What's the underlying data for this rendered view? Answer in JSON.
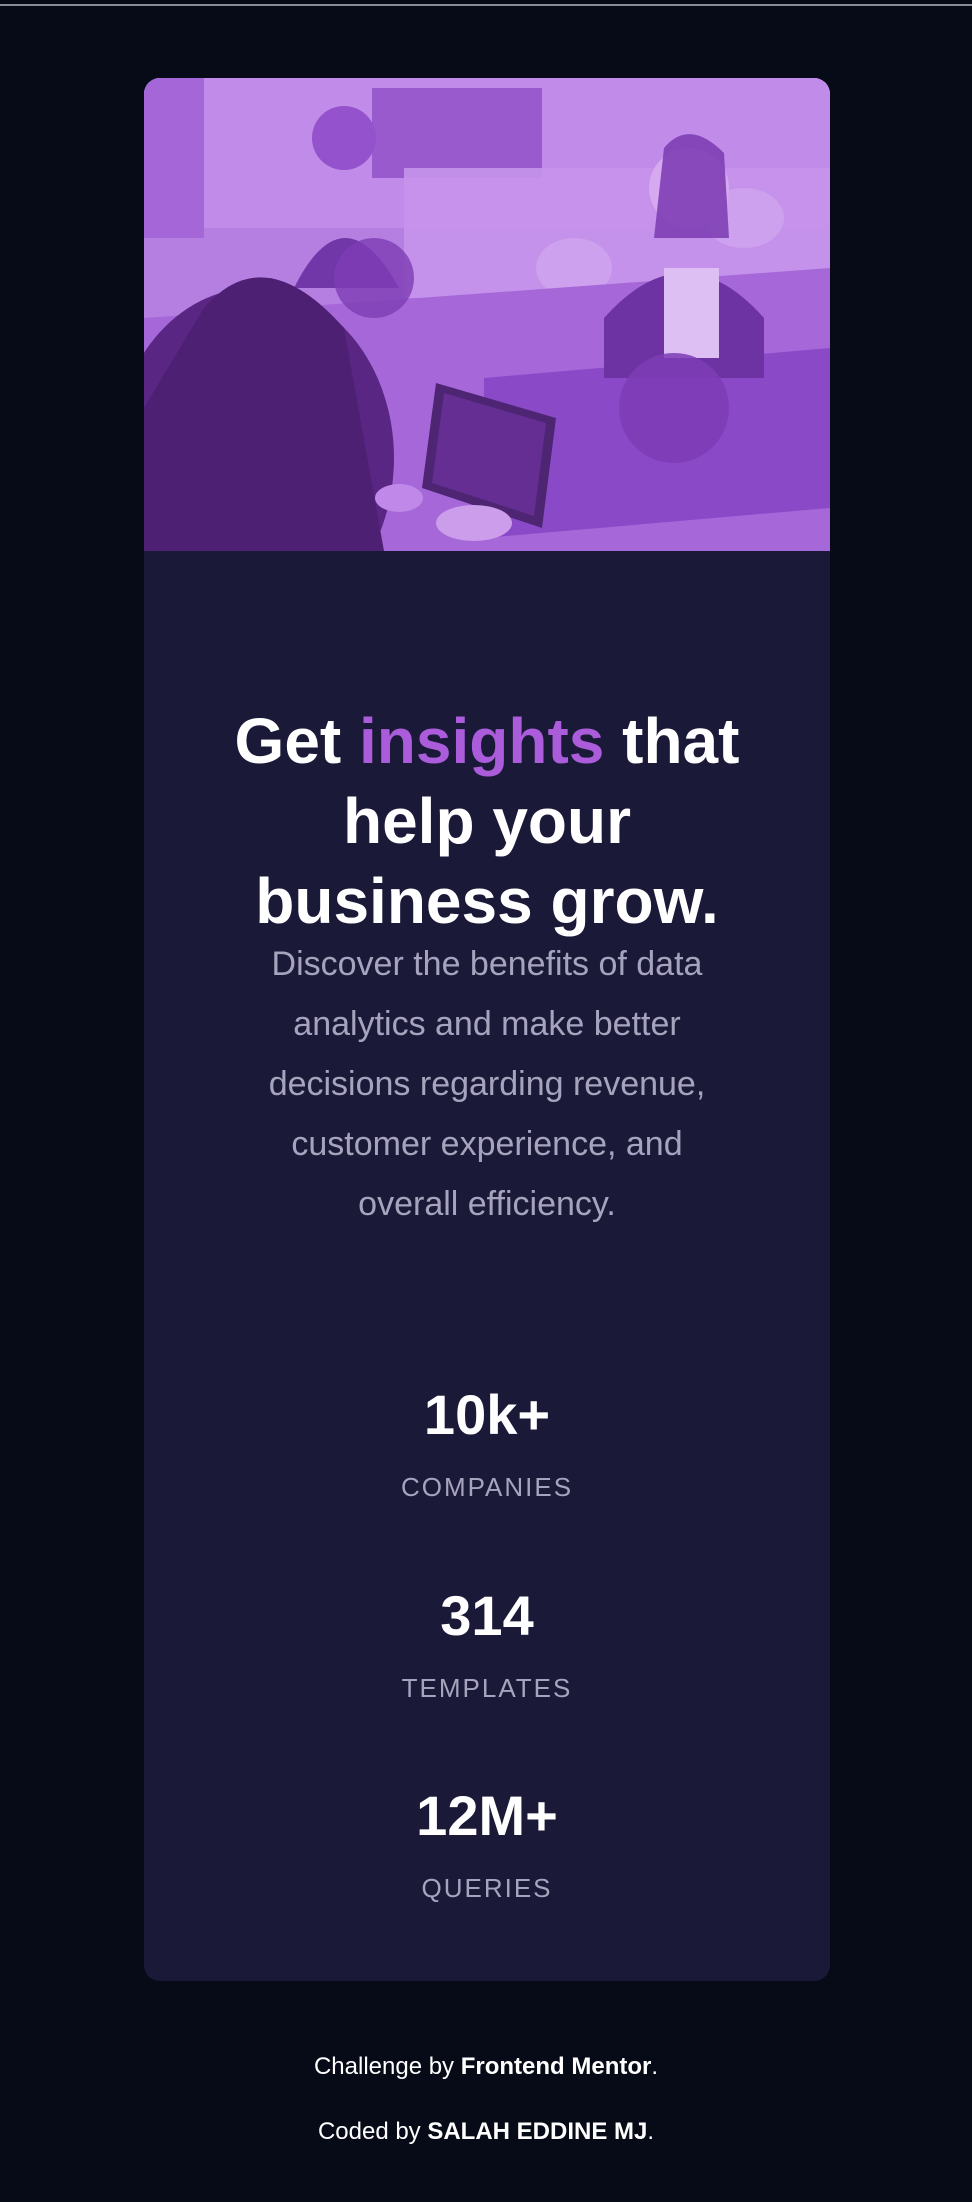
{
  "hero_image": {
    "alt": "People working at laptops in an office",
    "overlay_color": "#aa5cdb"
  },
  "headline": {
    "before": "Get ",
    "accent": "insights",
    "after_line1": " that",
    "line2": "help your",
    "line3": "business grow."
  },
  "description": "Discover the benefits of data analytics and make better decisions regarding revenue, customer experience, and overall efficiency.",
  "stats": [
    {
      "value": "10k+",
      "label": "COMPANIES"
    },
    {
      "value": "314",
      "label": "TEMPLATES"
    },
    {
      "value": "12M+",
      "label": "QUERIES"
    }
  ],
  "footer": {
    "challenge_prefix": "Challenge by ",
    "challenge_link": "Frontend Mentor",
    "challenge_suffix": ".",
    "coded_prefix": "Coded by ",
    "coded_author": "SALAH EDDINE MJ",
    "coded_suffix": "."
  },
  "colors": {
    "background": "#070b17",
    "card": "#1b1938",
    "accent": "#aa5cdb",
    "muted_text": "#a6a4bd"
  }
}
